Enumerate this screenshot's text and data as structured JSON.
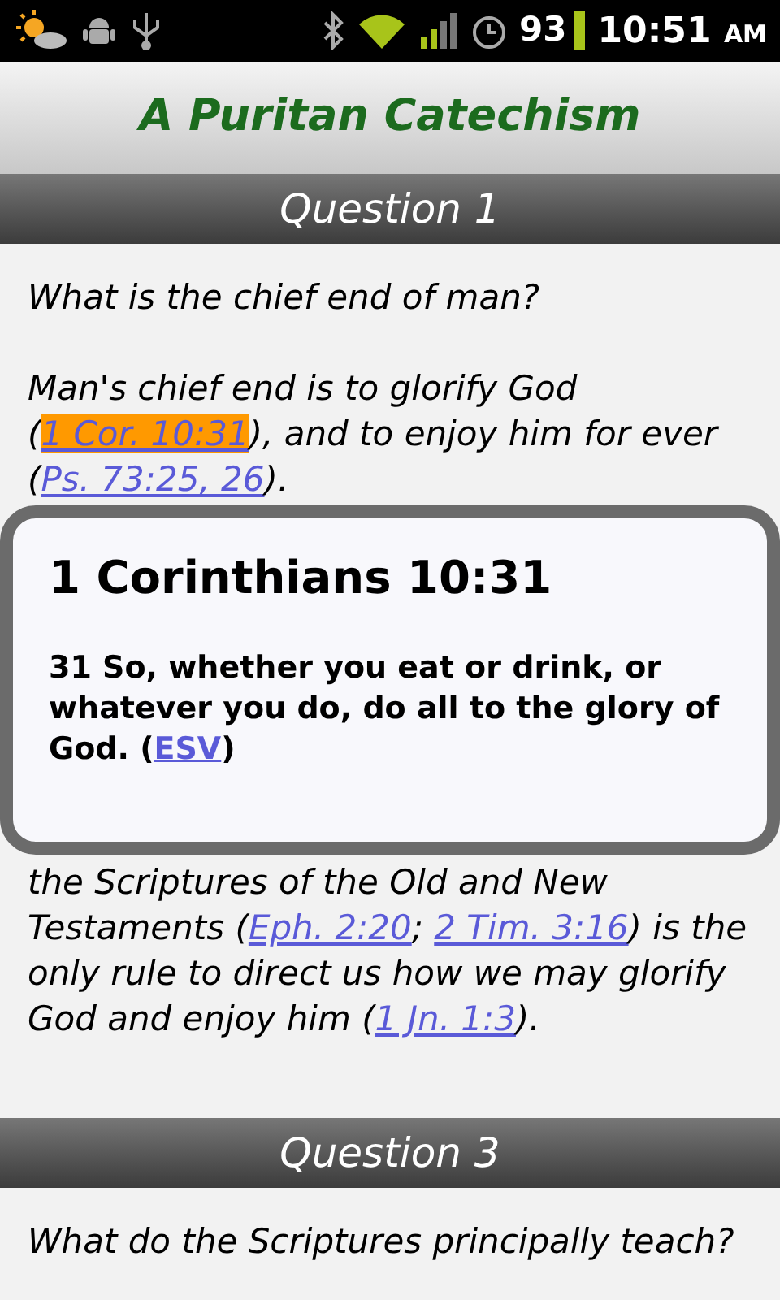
{
  "status_bar": {
    "battery": "93",
    "time": "10:51",
    "meridiem": "AM"
  },
  "title": "A Puritan Catechism",
  "questions": [
    {
      "heading": "Question 1",
      "question": "What is the chief end of man?",
      "answer": [
        {
          "kind": "text",
          "text": "Man's chief end is to glorify God ("
        },
        {
          "kind": "link",
          "text": "1 Cor. 10:31",
          "selected": true
        },
        {
          "kind": "text",
          "text": "), and to enjoy him for ever ("
        },
        {
          "kind": "link",
          "text": "Ps. 73:25, 26",
          "selected": false
        },
        {
          "kind": "text",
          "text": ")."
        }
      ]
    },
    {
      "answer": [
        {
          "kind": "text",
          "text": "the Scriptures of the Old and New Testaments ("
        },
        {
          "kind": "link",
          "text": "Eph. 2:20",
          "selected": false
        },
        {
          "kind": "text",
          "text": "; "
        },
        {
          "kind": "link",
          "text": "2 Tim. 3:16",
          "selected": false
        },
        {
          "kind": "text",
          "text": ") is the only rule to direct us how we may glorify God and enjoy him ("
        },
        {
          "kind": "link",
          "text": "1 Jn. 1:3",
          "selected": false
        },
        {
          "kind": "text",
          "text": ")."
        }
      ]
    },
    {
      "heading": "Question 3",
      "question": "What do the Scriptures principally teach?"
    }
  ],
  "popup": {
    "title": "1 Corinthians 10:31",
    "verse": [
      {
        "kind": "text",
        "text": "31 So, whether you eat or drink, or whatever you do, do all to the glory of God. ("
      },
      {
        "kind": "link",
        "text": "ESV"
      },
      {
        "kind": "text",
        "text": ")"
      }
    ]
  }
}
